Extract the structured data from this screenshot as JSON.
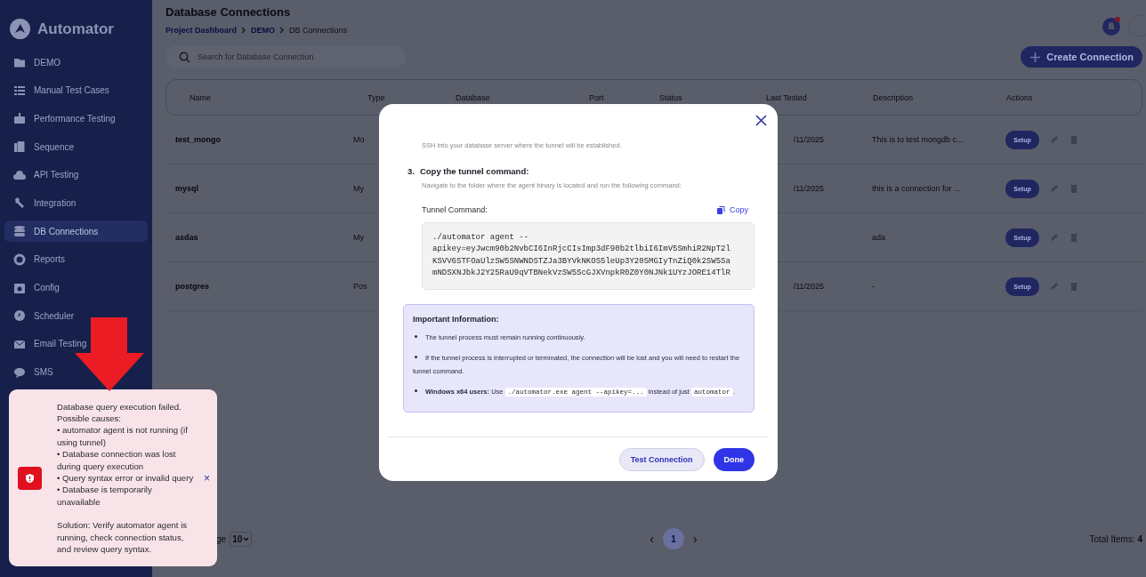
{
  "sidebar": {
    "logo": "Automator",
    "items": [
      {
        "label": "DEMO",
        "selected": false
      },
      {
        "label": "Manual Test Cases",
        "selected": false
      },
      {
        "label": "Performance Testing",
        "selected": false
      },
      {
        "label": "Sequence",
        "selected": false
      },
      {
        "label": "API Testing",
        "selected": false
      },
      {
        "label": "Integration",
        "selected": false
      },
      {
        "label": "DB Connections",
        "selected": true
      },
      {
        "label": "Reports",
        "selected": false
      },
      {
        "label": "Config",
        "selected": false
      },
      {
        "label": "Scheduler",
        "selected": false
      },
      {
        "label": "Email Testing",
        "selected": false
      },
      {
        "label": "SMS",
        "selected": false
      }
    ]
  },
  "header": {
    "title": "Database Connections",
    "breadcrumb": [
      {
        "label": "Project Dashboard",
        "link": true
      },
      {
        "label": "DEMO",
        "link": true
      },
      {
        "label": "DB Connections",
        "link": false
      }
    ],
    "notification": true
  },
  "search": {
    "placeholder": "Search for Database Connection"
  },
  "create_button": "Create Connection",
  "table": {
    "columns": [
      "Name",
      "Type",
      "Database",
      "Port",
      "Status",
      "Last Tested",
      "Description",
      "Actions"
    ],
    "rows": [
      {
        "name": "test_mongo",
        "type": "Mo",
        "last_tested": "/11/2025",
        "description": "This is to test mongdb c...",
        "action": "Setup"
      },
      {
        "name": "mysql",
        "type": "My",
        "last_tested": "/11/2025",
        "description": "this is a connection for ...",
        "action": "Setup"
      },
      {
        "name": "asdas",
        "type": "My",
        "description": "ada",
        "action": "Setup"
      },
      {
        "name": "postgres",
        "type": "Pos",
        "last_tested": "/11/2025",
        "description": "-",
        "action": "Setup"
      }
    ]
  },
  "pagination": {
    "rows_label": "ge",
    "page_size": "10",
    "pages": [
      {
        "label": "1",
        "selected": true
      }
    ],
    "prev": "‹",
    "next": "›",
    "total": "Total Items: **4**"
  },
  "modal": {
    "step_2_description": "SSH into your database server where the tunnel will be established.",
    "step_3": {
      "number": "3.",
      "title": "Copy the tunnel command:",
      "description": "Navigate to the folder where the agent binary is located and run the following command:"
    },
    "command_label": "Tunnel Command:",
    "copy": "Copy",
    "command": "./automator agent --\napikey=eyJwcm90b2NvbCI6InRjcCIsImp3dF90b2tlbiI6ImV5SmhiR2NpT2l\nKSVV6STFOaUlzSW5SNWNDSTZJa3BYVkNKOS5leUp3Y205MGIyTnZiQ0k2SW5Sa\nmNDSXNJbkJ2Y25RaU9qVTBNekVzSW5ScGJXVnpkR0Z0Y0NJNk1UYzJORE14TlR",
    "info_title": "Important Information:",
    "info_items": [
      [
        {
          "text": "The tunnel process must remain running continuously.",
          "kind": "plain"
        }
      ],
      [
        {
          "text": "If the tunnel process is interrupted or terminated, the connection will be lost and you will need to restart the tunnel command.",
          "kind": "plain"
        }
      ],
      [
        {
          "text": "Windows x64 users:",
          "kind": "bold"
        },
        {
          "text": " Use ",
          "kind": "plain"
        },
        {
          "text": "./automator.exe agent --apikey=...",
          "kind": "code"
        },
        {
          "text": " instead of just ",
          "kind": "plain"
        },
        {
          "text": "automator",
          "kind": "code"
        },
        {
          "text": ".",
          "kind": "plain"
        }
      ]
    ],
    "buttons": [
      {
        "label": "Test Connection",
        "kind": "secondary"
      },
      {
        "label": "Done",
        "kind": "primary"
      }
    ]
  },
  "toast": {
    "kind": "error",
    "message": "Database query execution failed.\nPossible causes:\n• automator agent is not running (if using tunnel)\n• Database connection was lost during query execution\n• Query syntax error or invalid query\n• Database is temporarily unavailable",
    "solution": "Solution: Verify automator agent is running, check connection status, and review query syntax.",
    "close": "×"
  }
}
